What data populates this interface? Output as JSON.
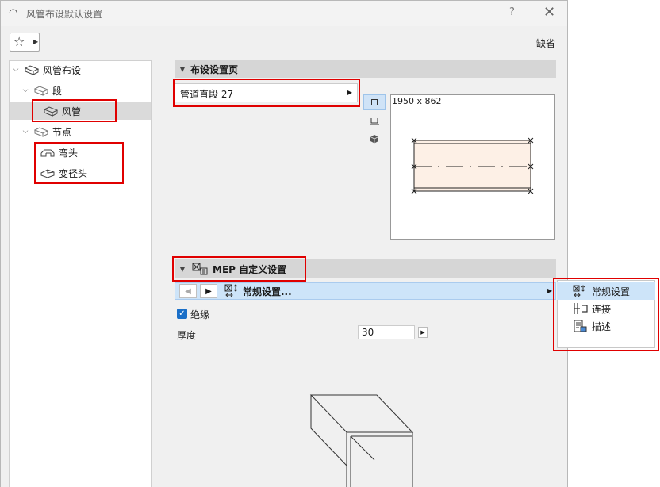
{
  "window": {
    "title": "风管布设默认设置",
    "help_label": "?",
    "close_label": "✕"
  },
  "toolbar": {
    "favorites_icon": "star-icon",
    "default_label": "缺省"
  },
  "tree": {
    "items": [
      {
        "label": "风管布设",
        "icon": "duct-routing-icon"
      },
      {
        "label": "段",
        "icon": "segment-icon"
      },
      {
        "label": "风管",
        "icon": "duct-icon",
        "selected": true
      },
      {
        "label": "节点",
        "icon": "node-icon"
      },
      {
        "label": "弯头",
        "icon": "elbow-icon"
      },
      {
        "label": "变径头",
        "icon": "transition-icon"
      }
    ]
  },
  "routing_panel": {
    "title": "布设设置页",
    "segment_dropdown": "管道直段 27",
    "preview_dimensions": "1950 x 862"
  },
  "mep_panel": {
    "title": "MEP 自定义设置",
    "current_page": "常规设置...",
    "insulation_label": "绝缘",
    "insulation_checked": true,
    "thickness_label": "厚度",
    "thickness_value": "30"
  },
  "popup_menu": {
    "items": [
      {
        "label": "常规设置",
        "icon": "general-settings-icon",
        "selected": true
      },
      {
        "label": "连接",
        "icon": "connection-icon"
      },
      {
        "label": "描述",
        "icon": "description-icon"
      }
    ]
  },
  "colors": {
    "highlight": "#e00000",
    "selection_blue": "#cde4f9",
    "section_header": "#d6d6d6"
  }
}
